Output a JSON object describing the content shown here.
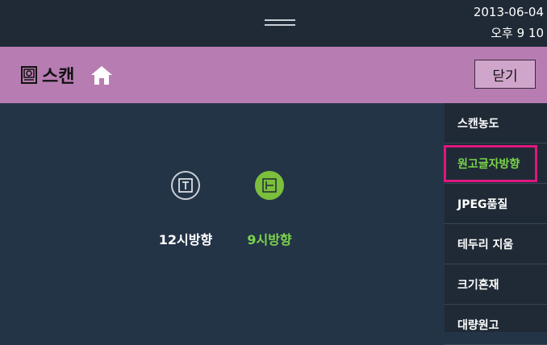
{
  "status": {
    "date": "2013-06-04",
    "time": "오후 9  10"
  },
  "header": {
    "title": "스캔",
    "close_label": "닫기"
  },
  "options": [
    {
      "label": "12시방향",
      "icon": "text-top-orientation-icon",
      "selected": false
    },
    {
      "label": "9시방향",
      "icon": "text-left-orientation-icon",
      "selected": true
    }
  ],
  "menu": {
    "items": [
      {
        "label": "스캔농도",
        "active": false
      },
      {
        "label": "원고글자방향",
        "active": true
      },
      {
        "label": "JPEG품질",
        "active": false
      },
      {
        "label": "테두리 지움",
        "active": false
      },
      {
        "label": "크기혼재",
        "active": false
      },
      {
        "label": "대량원고",
        "active": false
      }
    ]
  },
  "colors": {
    "header": "#b77db2",
    "accent": "#7bbf3c",
    "highlight": "#e0177f",
    "background": "#243447"
  }
}
